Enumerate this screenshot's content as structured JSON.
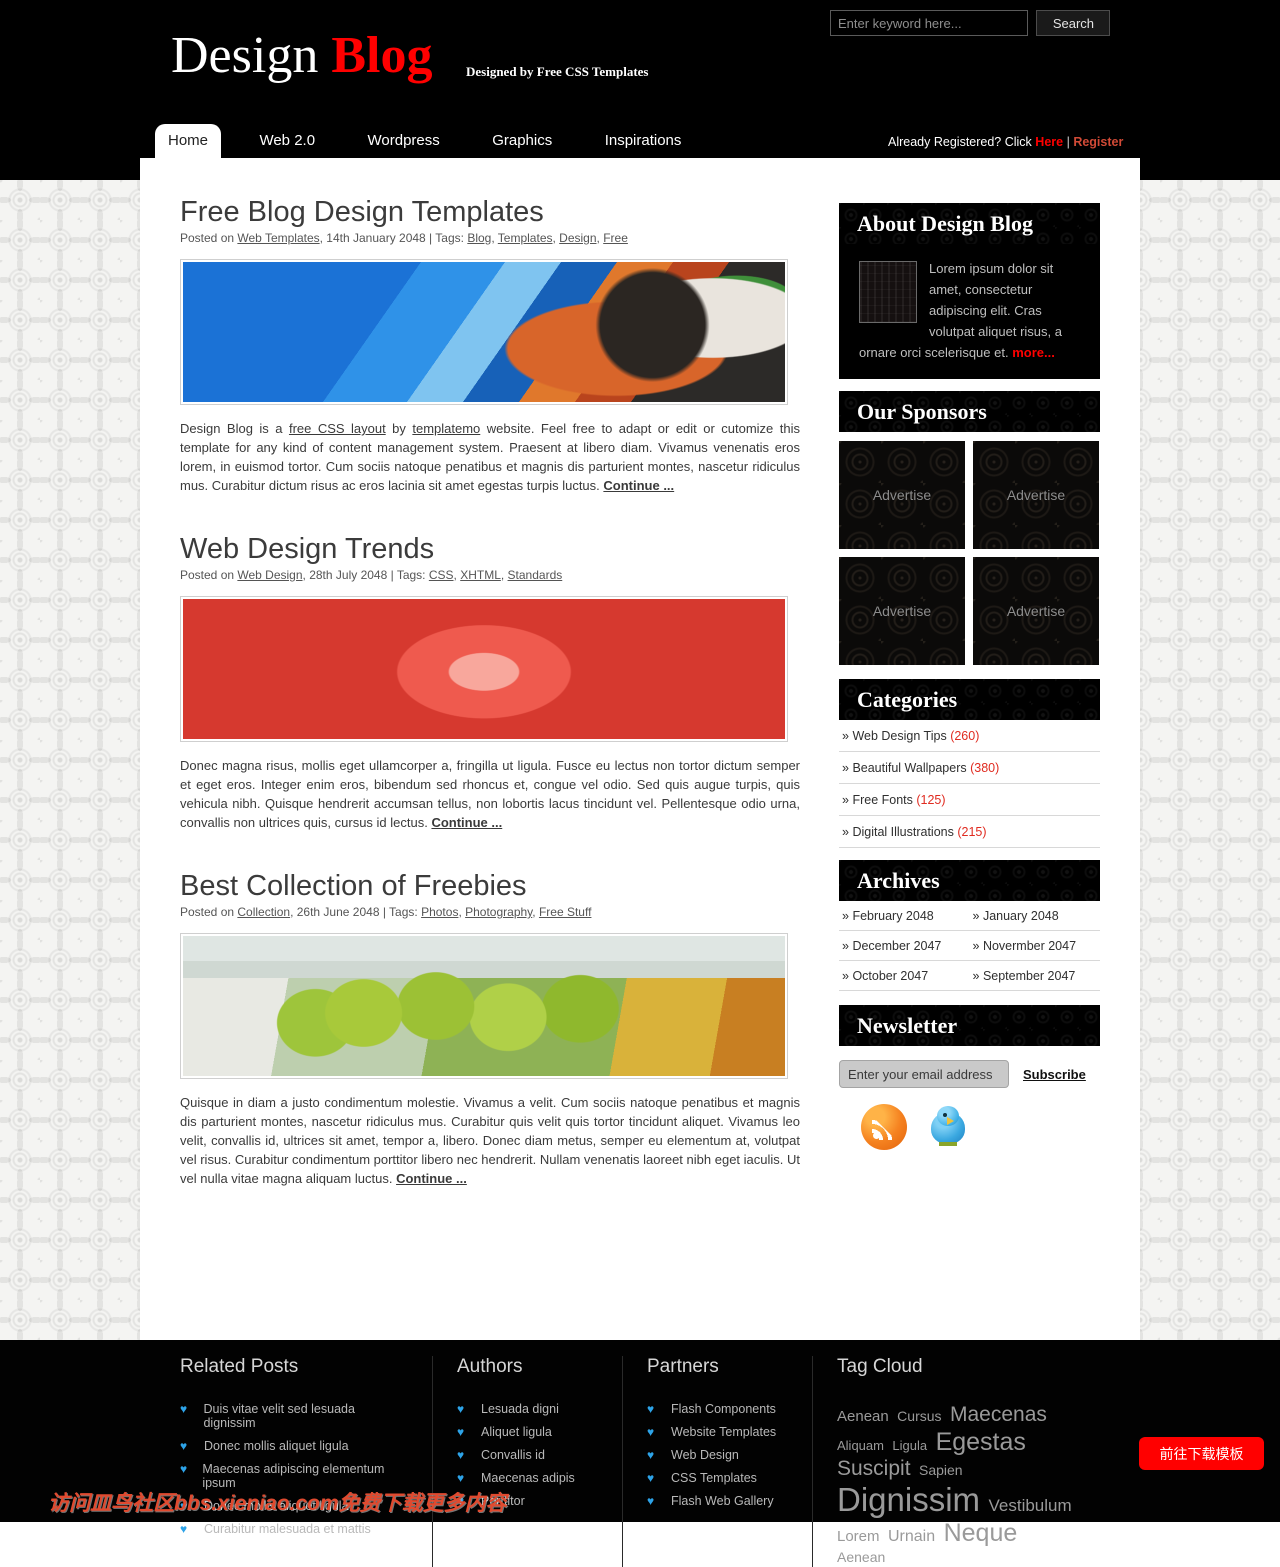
{
  "header": {
    "logo_main": "Design",
    "logo_accent": "Blog",
    "tagline": "Designed by Free CSS Templates",
    "search": {
      "placeholder": "Enter keyword here...",
      "value": "",
      "button_label": "Search"
    },
    "account": {
      "prompt": "Already Registered? Click",
      "here_label": "Here",
      "separator": "|",
      "register_label": "Register"
    }
  },
  "nav": {
    "items": [
      {
        "label": "Home",
        "active": true
      },
      {
        "label": "Web 2.0",
        "active": false
      },
      {
        "label": "Wordpress",
        "active": false
      },
      {
        "label": "Graphics",
        "active": false
      },
      {
        "label": "Inspirations",
        "active": false
      }
    ]
  },
  "posts": [
    {
      "title": "Free Blog Design Templates",
      "meta_prefix": "Posted on ",
      "category": "Web Templates",
      "date": ", 14th January 2048 | Tags: ",
      "tags": [
        "Blog",
        "Templates",
        "Design",
        "Free"
      ],
      "image_name": "parrot-photo",
      "body_html": "Design Blog is a <a href=\"#\">free CSS layout</a> by <a href=\"#\">templatemo</a> website. Feel free to adapt or edit or cutomize this template for any kind of content management system. Praesent at libero diam. Vivamus venenatis eros lorem, in euismod tortor. Cum sociis natoque penatibus et magnis dis parturient montes, nascetur ridiculus mus. Curabitur dictum risus ac eros lacinia sit amet egestas turpis luctus. ",
      "continue_label": "Continue ..."
    },
    {
      "title": "Web Design Trends",
      "meta_prefix": "Posted on ",
      "category": "Web Design",
      "date": ", 28th July 2048 | Tags: ",
      "tags": [
        "CSS",
        "XHTML",
        "Standards"
      ],
      "image_name": "flower-photo",
      "body_html": "Donec magna risus, mollis eget ullamcorper a, fringilla ut ligula. Fusce eu lectus non tortor dictum semper et eget eros. Integer enim eros, bibendum sed rhoncus et, congue vel odio. Sed quis augue turpis, quis vehicula nibh. Quisque hendrerit accumsan tellus, non lobortis lacus tincidunt vel. Pellentesque odio urna, convallis non ultrices quis, cursus id lectus. ",
      "continue_label": "Continue ..."
    },
    {
      "title": "Best Collection of Freebies",
      "meta_prefix": "Posted on ",
      "category": "Collection",
      "date": ", 26th June 2048 | Tags: ",
      "tags": [
        "Photos",
        "Photography",
        "Free Stuff"
      ],
      "image_name": "banana-photo",
      "body_html": "Quisque in diam a justo condimentum molestie. Vivamus a velit. Cum sociis natoque penatibus et magnis dis parturient montes, nascetur ridiculus mus. Curabitur quis velit quis tortor tincidunt aliquet. Vivamus leo velit, convallis id, ultrices sit amet, tempor a, libero. Donec diam metus, semper eu elementum at, volutpat vel risus. Curabitur condimentum porttitor libero nec hendrerit. Nullam venenatis laoreet nibh eget iaculis. Ut vel nulla vitae magna aliquam luctus. ",
      "continue_label": "Continue ..."
    }
  ],
  "sidebar": {
    "about": {
      "title": "About Design Blog",
      "text": "Lorem ipsum dolor sit amet, consectetur adipiscing elit. Cras volutpat aliquet risus, a ornare orci scelerisque et. ",
      "more_label": "more..."
    },
    "sponsors": {
      "title": "Our Sponsors",
      "ads": [
        "Advertise",
        "Advertise",
        "Advertise",
        "Advertise"
      ]
    },
    "categories": {
      "title": "Categories",
      "items": [
        {
          "label": "Web Design Tips",
          "count": "(260)"
        },
        {
          "label": "Beautiful Wallpapers",
          "count": "(380)"
        },
        {
          "label": "Free Fonts",
          "count": "(125)"
        },
        {
          "label": "Digital Illustrations",
          "count": "(215)"
        }
      ]
    },
    "archives": {
      "title": "Archives",
      "items": [
        "February 2048",
        "January 2048",
        "December 2047",
        "Novermber 2047",
        "October 2047",
        "September 2047"
      ]
    },
    "newsletter": {
      "title": "Newsletter",
      "placeholder": "Enter your email address",
      "value": "",
      "subscribe_label": "Subscribe",
      "social": [
        "rss-icon",
        "twitter-bird-icon"
      ]
    }
  },
  "footer": {
    "columns": [
      {
        "title": "Related Posts",
        "items": [
          "Duis vitae velit sed lesuada dignissim",
          "Donec mollis aliquet ligula",
          "Maecenas adipiscing elementum ipsum",
          "Donec mollis aliquet ligula",
          "Curabitur malesuada et mattis"
        ]
      },
      {
        "title": "Authors",
        "items": [
          "Lesuada digni",
          "Aliquet ligula",
          "Convallis id",
          "Maecenas adipis",
          "Porttitor"
        ]
      },
      {
        "title": "Partners",
        "items": [
          "Flash Components",
          "Website Templates",
          "Web Design",
          "CSS Templates",
          "Flash Web Gallery"
        ]
      }
    ],
    "tagcloud": {
      "title": "Tag Cloud",
      "tags": [
        {
          "label": "Aenean",
          "size": 15
        },
        {
          "label": "Cursus",
          "size": 14
        },
        {
          "label": "Maecenas",
          "size": 21
        },
        {
          "label": "Aliquam",
          "size": 13
        },
        {
          "label": "Ligula",
          "size": 13
        },
        {
          "label": "Egestas",
          "size": 25
        },
        {
          "label": "Suscipit",
          "size": 21
        },
        {
          "label": "Sapien",
          "size": 14
        },
        {
          "label": "Dignissim",
          "size": 33
        },
        {
          "label": "Vestibulum",
          "size": 17
        },
        {
          "label": "Lorem",
          "size": 15
        },
        {
          "label": "Urnain",
          "size": 16
        },
        {
          "label": "Neque",
          "size": 25
        },
        {
          "label": "Aenean",
          "size": 14
        }
      ]
    }
  },
  "overlay": {
    "watermark": "访问皿鸟社区bbs.xieniao.com免费下载更多内容",
    "download_button": "前往下载模板"
  },
  "colors": {
    "accent_red": "#ff0000",
    "register_red": "#d14a36",
    "link_underline": "#555555",
    "heading_gray": "#3b3b3b",
    "footer_heart_blue": "#2da3e8"
  }
}
